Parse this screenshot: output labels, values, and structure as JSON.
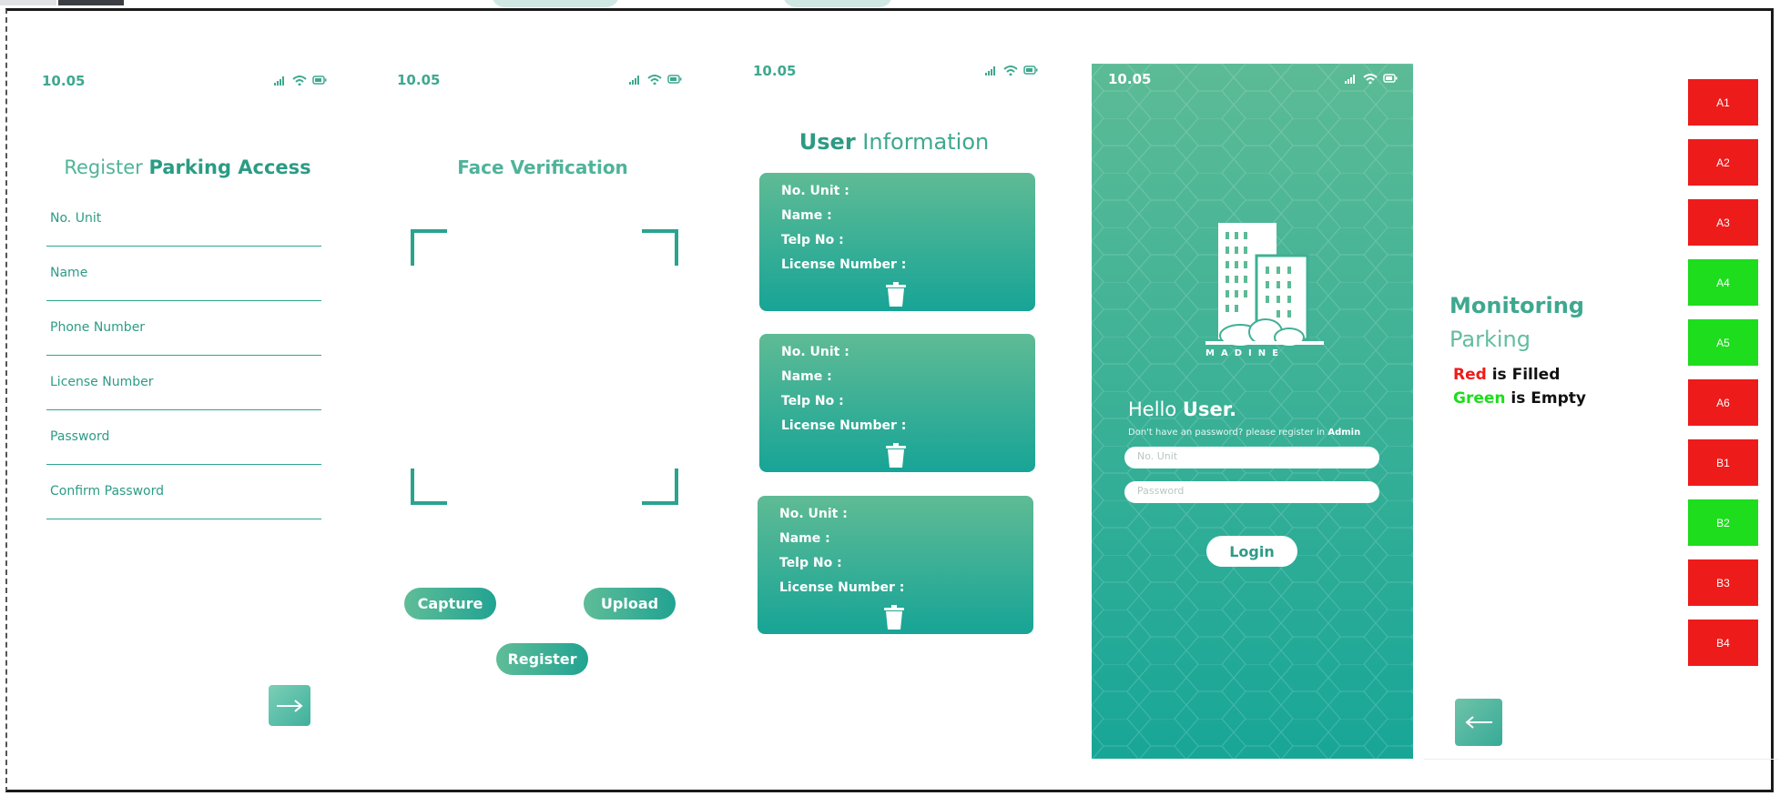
{
  "colors": {
    "accent": "#3ea88f",
    "filled": "#ee1b1b",
    "empty": "#1ddd1d"
  },
  "screen1": {
    "time": "10.05",
    "title_light": "Register",
    "title_bold": "Parking Access",
    "fields": [
      "No. Unit",
      "Name",
      "Phone Number",
      "License Number",
      "Password",
      "Confirm Password"
    ],
    "next_icon": "arrow-right-icon"
  },
  "screen2": {
    "time": "10.05",
    "title": "Face Verification",
    "capture_label": "Capture",
    "upload_label": "Upload",
    "register_label": "Register"
  },
  "screen3": {
    "time": "10.05",
    "title_bold": "User",
    "title_light": "Information",
    "cards": [
      {
        "no_unit": "No. Unit :",
        "name": "Name :",
        "telp": "Telp No :",
        "license": "License Number :"
      },
      {
        "no_unit": "No. Unit :",
        "name": "Name :",
        "telp": "Telp No :",
        "license": "License Number :"
      },
      {
        "no_unit": "No. Unit :",
        "name": "Name :",
        "telp": "Telp No :",
        "license": "License Number :"
      }
    ]
  },
  "screen4": {
    "time": "10.05",
    "brand": "MADINE",
    "hello_light": "Hello",
    "hello_bold": "User.",
    "hint_text": "Don't have an password? please register in",
    "hint_bold": "Admin",
    "unit_placeholder": "No. Unit",
    "password_placeholder": "Password",
    "login_label": "Login"
  },
  "screen5": {
    "title_line1": "Monitoring",
    "title_line2": "Parking",
    "legend_red_word": "Red",
    "legend_red_rest": "is Filled",
    "legend_green_word": "Green",
    "legend_green_rest": "is Empty",
    "slots": [
      {
        "label": "A1",
        "status": "filled"
      },
      {
        "label": "A2",
        "status": "filled"
      },
      {
        "label": "A3",
        "status": "filled"
      },
      {
        "label": "A4",
        "status": "empty"
      },
      {
        "label": "A5",
        "status": "empty"
      },
      {
        "label": "A6",
        "status": "filled"
      },
      {
        "label": "B1",
        "status": "filled"
      },
      {
        "label": "B2",
        "status": "empty"
      },
      {
        "label": "B3",
        "status": "filled"
      },
      {
        "label": "B4",
        "status": "filled"
      }
    ]
  }
}
